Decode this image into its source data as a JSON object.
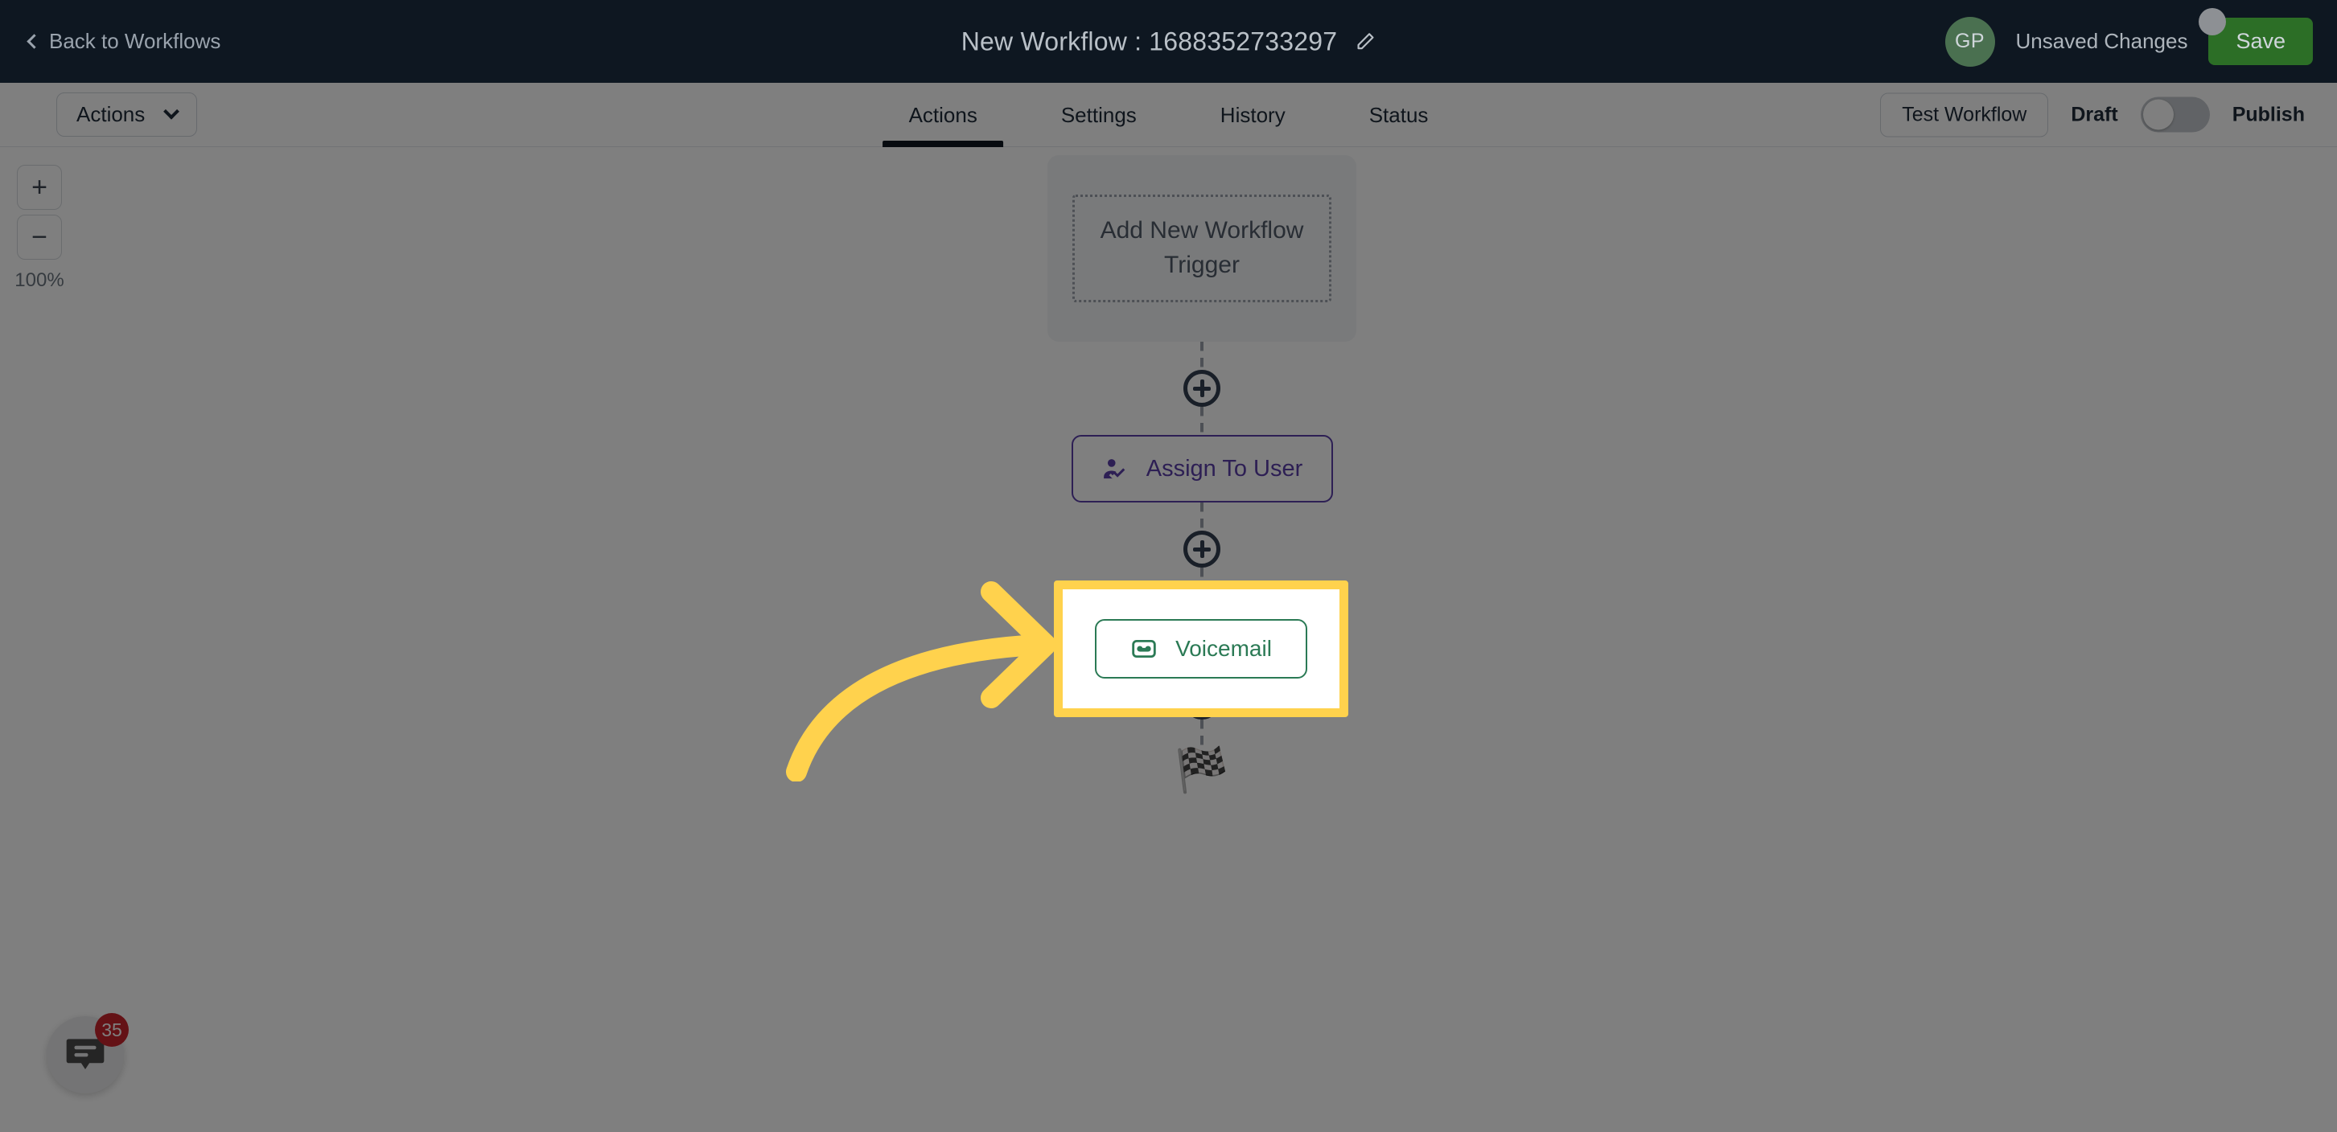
{
  "topbar": {
    "back_label": "Back to Workflows",
    "back_icon": "chevron-left-icon",
    "title": "New Workflow : 1688352733297",
    "edit_icon": "pencil-icon",
    "avatar_initials": "GP",
    "avatar_color": "#4a7050",
    "status_text": "Unsaved Changes",
    "save_label": "Save",
    "save_color": "#2c6e26",
    "background": "#0e1721"
  },
  "toolbar": {
    "actions_label": "Actions",
    "actions_icon": "chevron-down-icon",
    "tabs": [
      {
        "label": "Actions",
        "active": true
      },
      {
        "label": "Settings",
        "active": false
      },
      {
        "label": "History",
        "active": false
      },
      {
        "label": "Status",
        "active": false
      }
    ],
    "test_workflow_label": "Test Workflow",
    "draft_label": "Draft",
    "publish_label": "Publish",
    "toggle_state": "off"
  },
  "canvas": {
    "zoom": {
      "zoom_in_label": "+",
      "zoom_out_label": "−",
      "level_label": "100%"
    },
    "trigger": {
      "label": "Add New Workflow Trigger"
    },
    "nodes": [
      {
        "label": "Assign To User",
        "icon": "user-check-icon",
        "color": "#5b3fa8"
      },
      {
        "label": "Voicemail",
        "icon": "voicemail-icon",
        "color": "#2b7a55"
      }
    ],
    "end_icon": "checkered-flag-icon",
    "end_glyph": "🏁",
    "connector_icon": "plus-circle-icon"
  },
  "annotation": {
    "highlight_color": "#ffd24d",
    "arrow_icon": "curved-arrow-right-icon",
    "target": "Voicemail"
  },
  "chat_widget": {
    "icon": "chat-bubble-icon",
    "badge_count": "35",
    "badge_color": "#c9252d"
  }
}
